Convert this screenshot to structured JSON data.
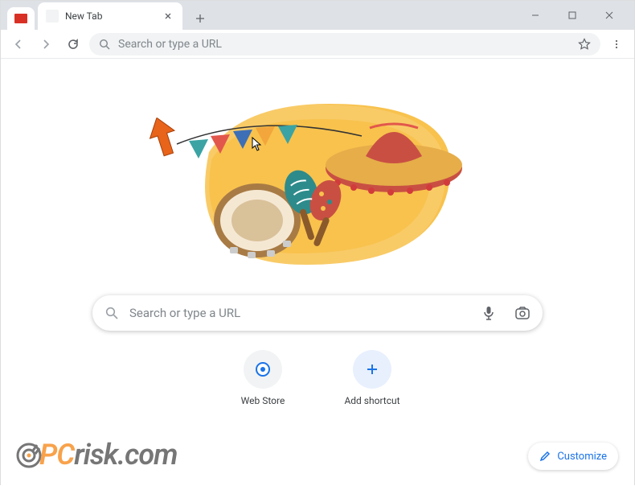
{
  "tab": {
    "title": "New Tab"
  },
  "omnibox": {
    "placeholder": "Search or type a URL"
  },
  "search": {
    "placeholder": "Search or type a URL"
  },
  "shortcuts": [
    {
      "label": "Web Store"
    },
    {
      "label": "Add shortcut"
    }
  ],
  "customize": {
    "label": "Customize"
  },
  "watermark": {
    "pre": "PC",
    "post": "risk.com"
  }
}
